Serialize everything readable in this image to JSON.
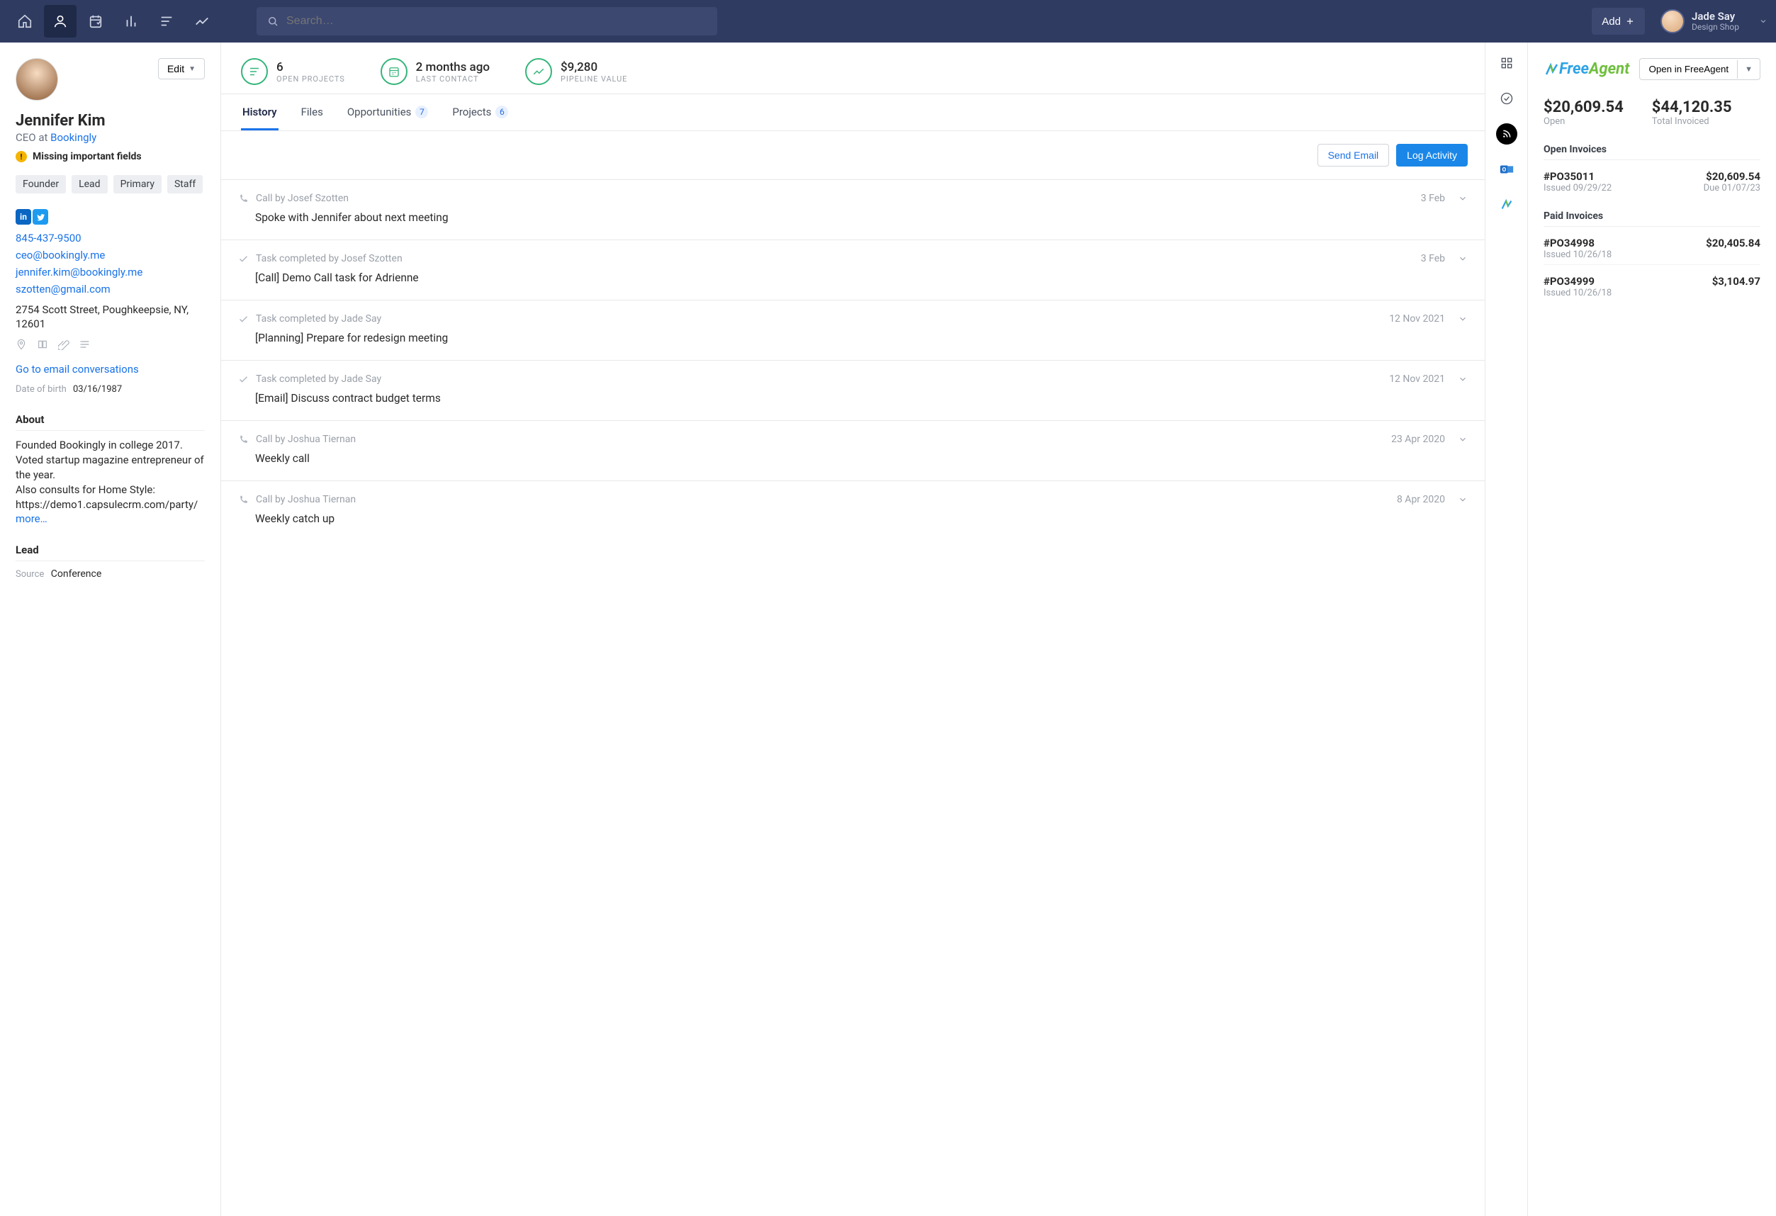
{
  "topnav": {
    "search_placeholder": "Search…",
    "add_label": "Add",
    "user": {
      "name": "Jade Say",
      "company": "Design Shop"
    }
  },
  "contact": {
    "name": "Jennifer Kim",
    "role_prefix": "CEO at ",
    "company": "Bookingly",
    "warning": "Missing important fields",
    "edit_label": "Edit",
    "tags": [
      "Founder",
      "Lead",
      "Primary",
      "Staff"
    ],
    "phone": "845-437-9500",
    "emails": [
      "ceo@bookingly.me",
      "jennifer.kim@bookingly.me",
      "szotten@gmail.com"
    ],
    "address": "2754 Scott Street, Poughkeepsie, NY, 12601",
    "conversations_link": "Go to email conversations",
    "dob_label": "Date of birth",
    "dob": "03/16/1987",
    "about_heading": "About",
    "about_text": "Founded Bookingly in college 2017.\nVoted startup magazine entrepreneur of the year.\nAlso consults for Home Style: https://demo1.capsulecrm.com/party/",
    "more_label": "more…",
    "lead_heading": "Lead",
    "source_label": "Source",
    "source_value": "Conference"
  },
  "stats": [
    {
      "value": "6",
      "label": "Open Projects",
      "icon": "list"
    },
    {
      "value": "2 months ago",
      "label": "Last Contact",
      "icon": "calendar"
    },
    {
      "value": "$9,280",
      "label": "Pipeline Value",
      "icon": "trend"
    }
  ],
  "tabs": [
    {
      "label": "History",
      "active": true
    },
    {
      "label": "Files"
    },
    {
      "label": "Opportunities",
      "count": "7"
    },
    {
      "label": "Projects",
      "count": "6"
    }
  ],
  "actions": {
    "send_email": "Send Email",
    "log_activity": "Log Activity"
  },
  "feed": [
    {
      "icon": "phone",
      "meta": "Call by Josef Szotten",
      "date": "3 Feb",
      "title": "Spoke with Jennifer about next meeting"
    },
    {
      "icon": "check",
      "meta": "Task completed by Josef Szotten",
      "date": "3 Feb",
      "title": "[Call] Demo Call task for Adrienne"
    },
    {
      "icon": "check",
      "meta": "Task completed by Jade Say",
      "date": "12 Nov 2021",
      "title": "[Planning] Prepare for redesign meeting"
    },
    {
      "icon": "check",
      "meta": "Task completed by Jade Say",
      "date": "12 Nov 2021",
      "title": "[Email] Discuss contract budget terms"
    },
    {
      "icon": "phone",
      "meta": "Call by Joshua Tiernan",
      "date": "23 Apr 2020",
      "title": "Weekly call"
    },
    {
      "icon": "phone",
      "meta": "Call by Joshua Tiernan",
      "date": "8 Apr 2020",
      "title": "Weekly catch up"
    }
  ],
  "freeagent": {
    "open_label": "Open in FreeAgent",
    "open_amount": "$20,609.54",
    "open_label2": "Open",
    "total_amount": "$44,120.35",
    "total_label": "Total Invoiced",
    "open_heading": "Open Invoices",
    "paid_heading": "Paid Invoices",
    "open_invoices": [
      {
        "num": "#PO35011",
        "issued": "Issued 09/29/22",
        "amount": "$20,609.54",
        "due": "Due 01/07/23"
      }
    ],
    "paid_invoices": [
      {
        "num": "#PO34998",
        "issued": "Issued 10/26/18",
        "amount": "$20,405.84"
      },
      {
        "num": "#PO34999",
        "issued": "Issued 10/26/18",
        "amount": "$3,104.97"
      }
    ]
  }
}
